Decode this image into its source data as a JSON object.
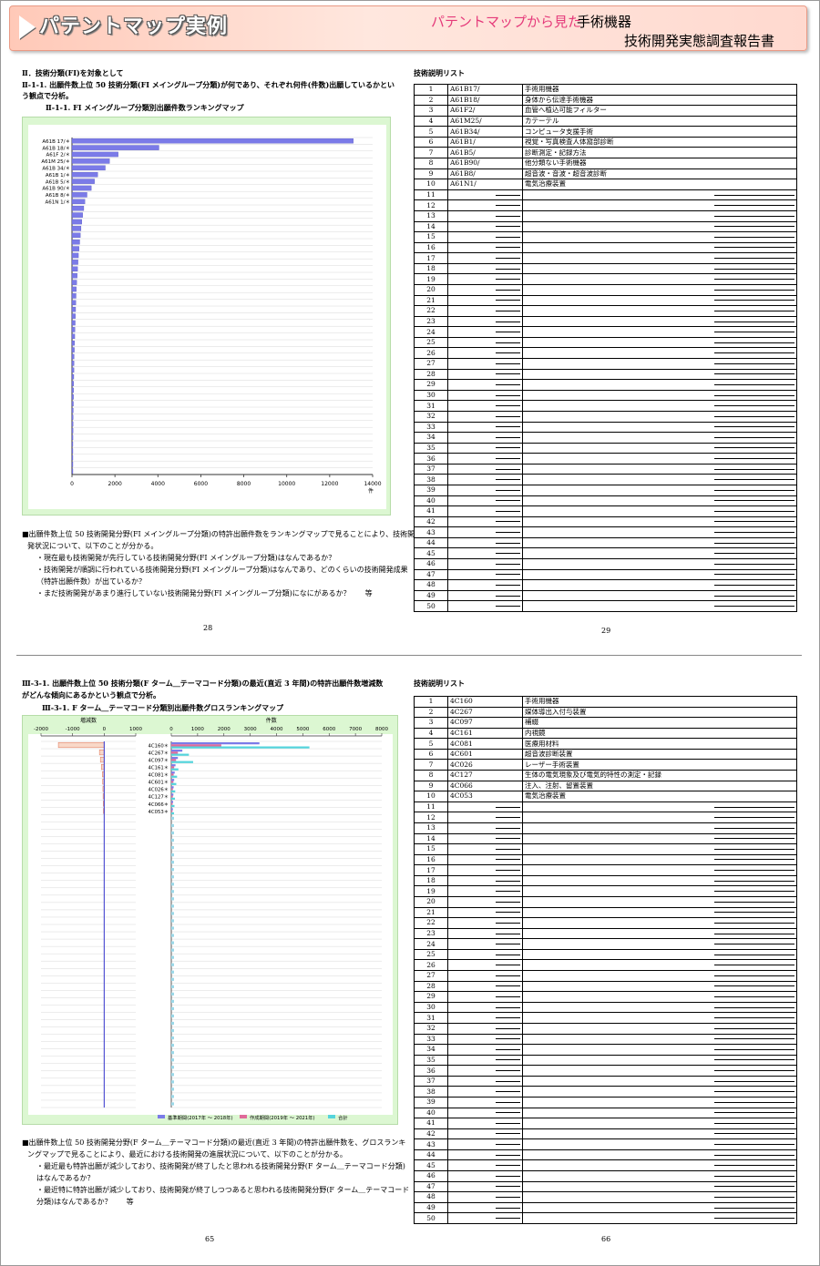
{
  "header": {
    "title": "パテントマップ実例",
    "subtitle_pink": "パテントマップから見た",
    "subtitle_topic": "手術機器",
    "subtitle_report": "技術開発実態調査報告書"
  },
  "top": {
    "section": "Ⅱ．技術分類(FI)を対象として",
    "heading_line1": "Ⅱ-1-1. 出願件数上位 50 技術分類(FI メイングループ分類)が何であり、それぞれ何件(件数)出願しているかとい",
    "heading_line2": "う観点で分析。",
    "chart_title": "Ⅱ-1-1. FI メイングループ分類別出願件数ランキングマップ",
    "desc_line1": "■出願件数上位 50 技術開発分野(FI メイングループ分類)の特許出願件数をランキングマップで見ることにより、技術開",
    "desc_line2": "発状況について、以下のことが分かる。",
    "bullets": [
      "・現在最も技術開発が先行している技術開発分野(FI メイングループ分類)はなんであるか？",
      "・技術開発が順調に行われている技術開発分野(FI メイングループ分類)はなんであり、どのくらいの技術開発成果",
      "（特許出願件数）が出ているか？",
      "・まだ技術開発があまり進行していない技術開発分野(FI メイングループ分類)になにがあるか？　　等"
    ],
    "page_left": "28",
    "list_title": "技術説明リスト",
    "page_right": "29",
    "list": [
      {
        "n": "1",
        "code": "A61B17/",
        "desc": "手術用機器"
      },
      {
        "n": "2",
        "code": "A61B18/",
        "desc": "身体から伝達手術機器"
      },
      {
        "n": "3",
        "code": "A61F2/",
        "desc": "血管へ植込可能フィルター"
      },
      {
        "n": "4",
        "code": "A61M25/",
        "desc": "カテーテル"
      },
      {
        "n": "5",
        "code": "A61B34/",
        "desc": "コンピュータ支援手術"
      },
      {
        "n": "6",
        "code": "A61B1/",
        "desc": "視覚・写真検査人体窩部診断"
      },
      {
        "n": "7",
        "code": "A61B5/",
        "desc": "診断測定・記録方法"
      },
      {
        "n": "8",
        "code": "A61B90/",
        "desc": "他分類ない手術機器"
      },
      {
        "n": "9",
        "code": "A61B8/",
        "desc": "超音波・音波・超音波診断"
      },
      {
        "n": "10",
        "code": "A61N1/",
        "desc": "電気治療装置"
      }
    ]
  },
  "bottom": {
    "heading_line1": "Ⅲ-3-1. 出願件数上位 50 技術分類(F ターム＿テーマコード分類)の最近(直近 3 年間)の特許出願件数増減数",
    "heading_line2": "がどんな傾向にあるかという観点で分析。",
    "chart_title": "Ⅲ-3-1. F ターム＿テーマコード分類別出願件数グロスランキングマップ",
    "desc_line1": "■出願件数上位 50 技術開発分野(F ターム＿テーマコード分類)の最近(直近 3 年間)の特許出願件数を、グロスランキ",
    "desc_line2": "ングマップで見ることにより、最近における技術開発の進展状況について、以下のことが分かる。",
    "bullets": [
      "・最近最も特許出願が減少しており、技術開発が終了したと思われる技術開発分野(F ターム＿テーマコード分類)",
      "はなんであるか？",
      "・最近特に特許出願が減少しており、技術開発が終了しつつあると思われる技術開発分野(F ターム＿テーマコード",
      "分類)はなんであるか？　　等"
    ],
    "page_left": "65",
    "list_title": "技術説明リスト",
    "page_right": "66",
    "list": [
      {
        "n": "1",
        "code": "4C160",
        "desc": "手術用機器"
      },
      {
        "n": "2",
        "code": "4C267",
        "desc": "媒体導出入付与装置"
      },
      {
        "n": "3",
        "code": "4C097",
        "desc": "補綴"
      },
      {
        "n": "4",
        "code": "4C161",
        "desc": "内視鏡"
      },
      {
        "n": "5",
        "code": "4C081",
        "desc": "医療用材料"
      },
      {
        "n": "6",
        "code": "4C601",
        "desc": "超音波診断装置"
      },
      {
        "n": "7",
        "code": "4C026",
        "desc": "レーザー手術装置"
      },
      {
        "n": "8",
        "code": "4C127",
        "desc": "生体の電気現象及び電気的特性の測定・記録"
      },
      {
        "n": "9",
        "code": "4C066",
        "desc": "注入、注射、留置装置"
      },
      {
        "n": "10",
        "code": "4C053",
        "desc": "電気治療装置"
      }
    ]
  },
  "chart_data": [
    {
      "type": "bar",
      "orientation": "horizontal",
      "categories": [
        "A61B 17/＊",
        "A61B 18/＊",
        "A61F 2/＊",
        "A61M 25/＊",
        "A61B 34/＊",
        "A61B 1/＊",
        "A61B 5/＊",
        "A61B 90/＊",
        "A61B 8/＊",
        "A61N 1/＊"
      ],
      "values": [
        13100,
        4050,
        2150,
        1750,
        1550,
        1200,
        1050,
        900,
        700,
        600
      ],
      "tail_values": [
        550,
        500,
        460,
        420,
        390,
        360,
        330,
        300,
        280,
        260,
        240,
        220,
        200,
        190,
        180,
        170,
        160,
        150,
        140,
        130,
        120,
        110,
        100,
        95,
        90,
        85,
        80,
        75,
        70,
        65,
        60,
        55,
        50,
        48,
        45,
        42,
        40,
        38,
        35,
        32
      ],
      "xticks": [
        0,
        2000,
        4000,
        6000,
        8000,
        10000,
        12000,
        14000
      ],
      "xlim": [
        0,
        14000
      ],
      "xlabel": "件",
      "color": "#7b7be8"
    },
    {
      "type": "bar",
      "orientation": "horizontal",
      "categories": [
        "4C160＊",
        "4C267＊",
        "4C097＊",
        "4C161＊",
        "4C081＊",
        "4C601＊",
        "4C026＊",
        "4C127＊",
        "4C066＊",
        "4C053＊"
      ],
      "left_panel": {
        "label": "増減数",
        "xticks": [
          -2000,
          -1000,
          0,
          1000
        ],
        "xlim": [
          -2000,
          1000
        ],
        "values": [
          -1450,
          -150,
          -120,
          -90,
          -60,
          -50,
          -40,
          -35,
          -30,
          -25
        ]
      },
      "right_panel": {
        "label": "件数",
        "xticks": [
          0,
          1000,
          2000,
          3000,
          4000,
          5000,
          6000,
          7000,
          8000
        ],
        "xlim": [
          0,
          8000
        ],
        "series": [
          {
            "name": "基準期間(2017年 ～ 2018年)",
            "color": "#7b7be8",
            "values": [
              3350,
              420,
              250,
              160,
              130,
              110,
              90,
              80,
              70,
              60
            ]
          },
          {
            "name": "作成期間(2019年 ～ 2021年)",
            "color": "#e06a9a",
            "values": [
              1900,
              250,
              180,
              110,
              90,
              80,
              60,
              60,
              50,
              45
            ]
          },
          {
            "name": "合計",
            "color": "#55d4dc",
            "values": [
              5250,
              670,
              830,
              270,
              220,
              190,
              150,
              140,
              120,
              105
            ]
          }
        ]
      }
    }
  ]
}
